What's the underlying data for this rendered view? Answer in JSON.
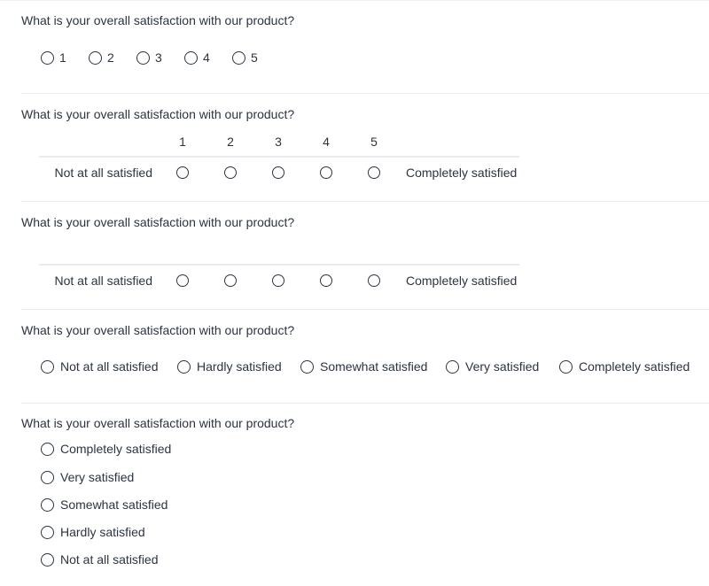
{
  "question": "What is your overall satisfaction with our product?",
  "scale_numbers": [
    "1",
    "2",
    "3",
    "4",
    "5"
  ],
  "matrix": {
    "low_label": "Not at all satisfied",
    "high_label": "Completely satisfied"
  },
  "horizontal_labels": [
    "Not at all satisfied",
    "Hardly satisfied",
    "Somewhat satisfied",
    "Very satisfied",
    "Completely satisfied"
  ],
  "vertical_labels": [
    "Completely satisfied",
    "Very satisfied",
    "Somewhat satisfied",
    "Hardly satisfied",
    "Not at all satisfied"
  ],
  "sections": [
    {
      "type": "numeric-radio",
      "title": "What is your overall satisfaction with our product?"
    },
    {
      "type": "matrix-with-numbers",
      "title": "What is your overall satisfaction with our product?"
    },
    {
      "type": "matrix-without-numbers",
      "title": "What is your overall satisfaction with our product?"
    },
    {
      "type": "horizontal-labeled-radio",
      "title": "What is your overall satisfaction with our product?"
    },
    {
      "type": "vertical-labeled-radio",
      "title": "What is your overall satisfaction with our product?"
    }
  ],
  "colors": {
    "text": "#2b3441",
    "divider": "#e9ebee",
    "background": "#ffffff"
  }
}
